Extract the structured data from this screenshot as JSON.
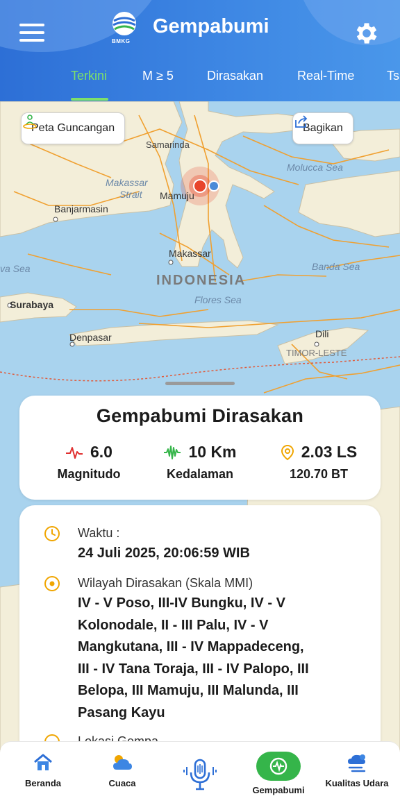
{
  "app": {
    "title": "Gempabumi",
    "logo_text": "BMKG"
  },
  "header": {
    "tabs": [
      {
        "label": "Terkini",
        "active": true
      },
      {
        "label": "M ≥ 5",
        "active": false
      },
      {
        "label": "Dirasakan",
        "active": false
      },
      {
        "label": "Real-Time",
        "active": false
      },
      {
        "label": "Ts",
        "active": false
      }
    ]
  },
  "map": {
    "shake_map_button": "Peta Guncangan",
    "share_button": "Bagikan",
    "labels": {
      "samarinda": "Samarinda",
      "makassar_strait_1": "Makassar",
      "makassar_strait_2": "Strait",
      "mamuju": "Mamuju",
      "banjarmasin": "Banjarmasin",
      "molucca_sea": "Molucca Sea",
      "makassar": "Makassar",
      "java_sea": "va Sea",
      "indonesia": "INDONESIA",
      "banda_sea": "Banda Sea",
      "surabaya": "Surabaya",
      "flores_sea": "Flores Sea",
      "denpasar": "Denpasar",
      "dili": "Dili",
      "timor_leste": "TIMOR-LESTE"
    }
  },
  "summary": {
    "title": "Gempabumi Dirasakan",
    "magnitude": {
      "value": "6.0",
      "label": "Magnitudo"
    },
    "depth": {
      "value": "10 Km",
      "label": "Kedalaman"
    },
    "location": {
      "value": "2.03 LS",
      "label": "120.70 BT"
    }
  },
  "details": {
    "time_label": "Waktu :",
    "time_value": "24 Juli 2025, 20:06:59 WIB",
    "felt_label": "Wilayah Dirasakan (Skala MMI)",
    "felt_lines": [
      "IV - V Poso, III-IV Bungku, IV - V",
      "Kolonodale, II - III Palu, IV - V",
      "Mangkutana, III - IV Mappadeceng,",
      "III - IV Tana Toraja, III - IV Palopo, III",
      "Belopa, III Mamuju, III Malunda, III",
      "Pasang Kayu"
    ],
    "location_label": "Lokasi Gempa"
  },
  "bottom_nav": [
    {
      "label": "Beranda",
      "icon": "house-icon"
    },
    {
      "label": "Cuaca",
      "icon": "weather-icon"
    },
    {
      "label": "",
      "icon": "microphone-icon"
    },
    {
      "label": "Gempabumi",
      "icon": "seismograph-icon",
      "active": true
    },
    {
      "label": "Kualitas Udara",
      "icon": "air-quality-icon"
    }
  ],
  "colors": {
    "header_blue": "#2d6fd6",
    "active_tab": "#7ee06a",
    "active_nav": "#35b54a",
    "epicenter": "#e8452c",
    "icon_orange": "#f0a500"
  }
}
